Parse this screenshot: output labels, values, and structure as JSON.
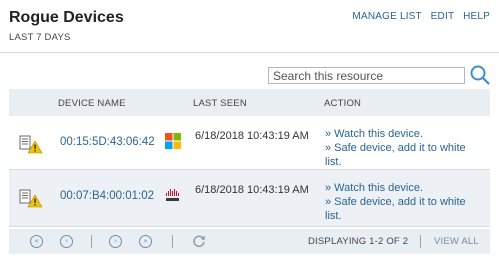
{
  "header": {
    "title": "Rogue Devices",
    "subtitle": "LAST 7 DAYS",
    "links": [
      "MANAGE LIST",
      "EDIT",
      "HELP"
    ]
  },
  "search": {
    "placeholder": "Search this resource"
  },
  "table": {
    "columns": [
      "DEVICE NAME",
      "LAST SEEN",
      "ACTION"
    ],
    "rows": [
      {
        "mac": "00:15:5D:43:06:42",
        "vendor_icon": "windows-icon",
        "last_seen": "6/18/2018 10:43:19 AM",
        "action_watch": "» Watch this device.",
        "action_safe": "» Safe device, add it to white list."
      },
      {
        "mac": "00:07:B4:00:01:02",
        "vendor_icon": "cisco-icon",
        "last_seen": "6/18/2018 10:43:19 AM",
        "action_watch": "» Watch this device.",
        "action_safe": "» Safe device, add it to white list."
      }
    ]
  },
  "footer": {
    "displaying": "DISPLAYING 1-2 OF 2",
    "view_all": "VIEW ALL"
  },
  "colors": {
    "link": "#2a6496",
    "header_bg": "#e9eef3",
    "warning": "#f2c200",
    "windows_red": "#f25022",
    "windows_green": "#7fba00",
    "windows_blue": "#00a4ef",
    "windows_yellow": "#ffb900",
    "cisco_red": "#c8102e"
  }
}
